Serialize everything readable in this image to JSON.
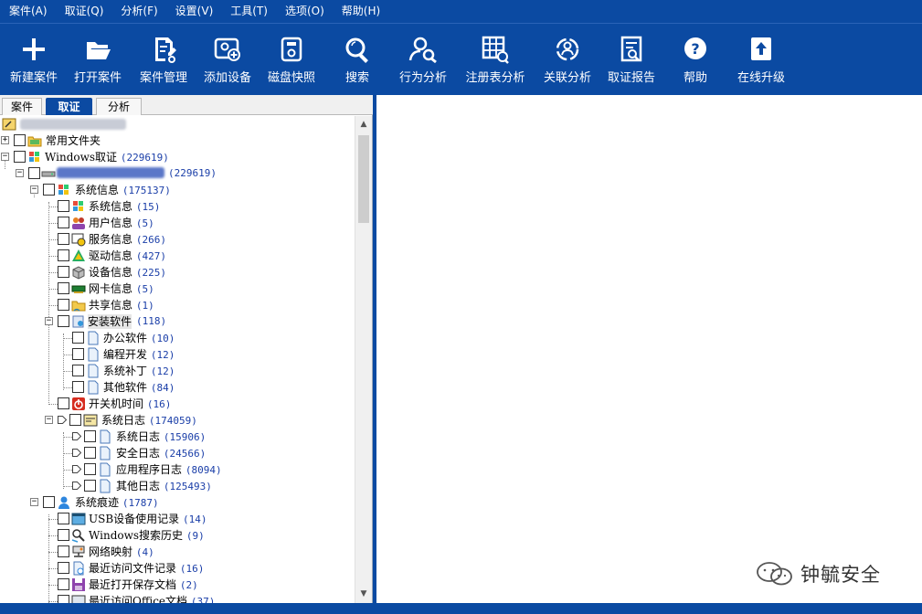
{
  "menubar": [
    "案件(A)",
    "取证(Q)",
    "分析(F)",
    "设置(V)",
    "工具(T)",
    "选项(O)",
    "帮助(H)"
  ],
  "toolbar": [
    {
      "label": "新建案件",
      "icon": "plus-icon"
    },
    {
      "label": "打开案件",
      "icon": "folder-open-icon"
    },
    {
      "label": "案件管理",
      "icon": "case-manage-icon"
    },
    {
      "label": "添加设备",
      "icon": "add-device-icon"
    },
    {
      "label": "磁盘快照",
      "icon": "disk-snapshot-icon"
    },
    {
      "label": "搜索",
      "icon": "search-icon"
    },
    {
      "label": "行为分析",
      "icon": "behavior-analysis-icon"
    },
    {
      "label": "注册表分析",
      "icon": "registry-icon"
    },
    {
      "label": "关联分析",
      "icon": "relation-icon"
    },
    {
      "label": "取证报告",
      "icon": "report-icon"
    },
    {
      "label": "帮助",
      "icon": "help-icon"
    },
    {
      "label": "在线升级",
      "icon": "upgrade-icon"
    }
  ],
  "tabs": [
    "案件",
    "取证",
    "分析"
  ],
  "active_tab": "取证",
  "tree": [
    {
      "label": "常用文件夹",
      "count": ""
    },
    {
      "label": "Windows取证",
      "count": "(229619)"
    },
    {
      "label": "",
      "count": "(229619)"
    },
    {
      "label": "系统信息",
      "count": "(175137)"
    },
    {
      "label": "系统信息",
      "count": "(15)"
    },
    {
      "label": "用户信息",
      "count": "(5)"
    },
    {
      "label": "服务信息",
      "count": "(266)"
    },
    {
      "label": "驱动信息",
      "count": "(427)"
    },
    {
      "label": "设备信息",
      "count": "(225)"
    },
    {
      "label": "网卡信息",
      "count": "(5)"
    },
    {
      "label": "共享信息",
      "count": "(1)"
    },
    {
      "label": "安装软件",
      "count": "(118)"
    },
    {
      "label": "办公软件",
      "count": "(10)"
    },
    {
      "label": "编程开发",
      "count": "(12)"
    },
    {
      "label": "系统补丁",
      "count": "(12)"
    },
    {
      "label": "其他软件",
      "count": "(84)"
    },
    {
      "label": "开关机时间",
      "count": "(16)"
    },
    {
      "label": "系统日志",
      "count": "(174059)"
    },
    {
      "label": "系统日志",
      "count": "(15906)"
    },
    {
      "label": "安全日志",
      "count": "(24566)"
    },
    {
      "label": "应用程序日志",
      "count": "(8094)"
    },
    {
      "label": "其他日志",
      "count": "(125493)"
    },
    {
      "label": "系统痕迹",
      "count": "(1787)"
    },
    {
      "label": "USB设备使用记录",
      "count": "(14)"
    },
    {
      "label": "Windows搜索历史",
      "count": "(9)"
    },
    {
      "label": "网络映射",
      "count": "(4)"
    },
    {
      "label": "最近访问文件记录",
      "count": "(16)"
    },
    {
      "label": "最近打开保存文档",
      "count": "(2)"
    },
    {
      "label": "最近访问Office文档",
      "count": "(37)"
    }
  ],
  "watermark": "钟毓安全",
  "colors": {
    "brand": "#0b4aa2",
    "count_text": "#1a3ea8"
  }
}
